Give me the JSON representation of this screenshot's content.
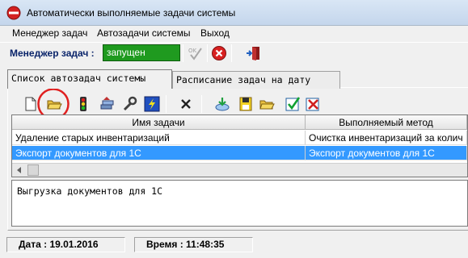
{
  "window": {
    "title": "Автоматически выполняемые задачи системы"
  },
  "menu": [
    "Менеджер задач",
    "Автозадачи системы",
    "Выход"
  ],
  "status_toolbar": {
    "label": "Менеджер задач :",
    "value": "запущен"
  },
  "tabs": [
    "Список автозадач системы",
    "Расписание задач на дату"
  ],
  "grid": {
    "columns": [
      "Имя задачи",
      "Выполняемый метод"
    ],
    "rows": [
      [
        "Удаление старых инвентаризаций",
        "Очистка инвентаризаций за колич"
      ],
      [
        "Экспорт документов для 1С",
        "Экспорт документов для 1С"
      ]
    ],
    "selected_row": 1
  },
  "description": "Выгрузка документов для 1С",
  "statusbar": {
    "date": "Дата : 19.01.2016",
    "time": "Время : 11:48:35"
  }
}
